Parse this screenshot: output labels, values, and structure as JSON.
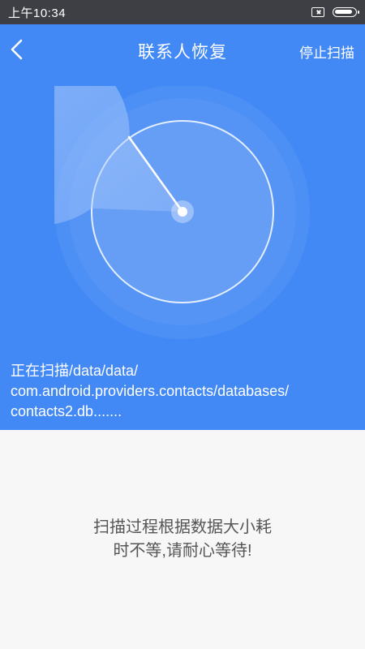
{
  "status_bar": {
    "time": "上午10:34",
    "sim_icon": "sim-disabled-icon",
    "battery_icon": "battery-icon",
    "battery_level_percent": 95
  },
  "header": {
    "back_icon": "chevron-left-icon",
    "title": "联系人恢复",
    "stop_label": "停止扫描"
  },
  "scan": {
    "radar_icon": "radar-scan-icon",
    "path_line1": "正在扫描/data/data/",
    "path_line2": "com.android.providers.contacts/databases/",
    "path_line3": "contacts2.db......."
  },
  "hint": {
    "line1": "扫描过程根据数据大小耗",
    "line2": "时不等,请耐心等待!"
  },
  "colors": {
    "status_bar_bg": "#3d3f44",
    "header_bg": "#4389f5",
    "body_bg": "#f7f7f7",
    "hint_text": "#555555"
  }
}
